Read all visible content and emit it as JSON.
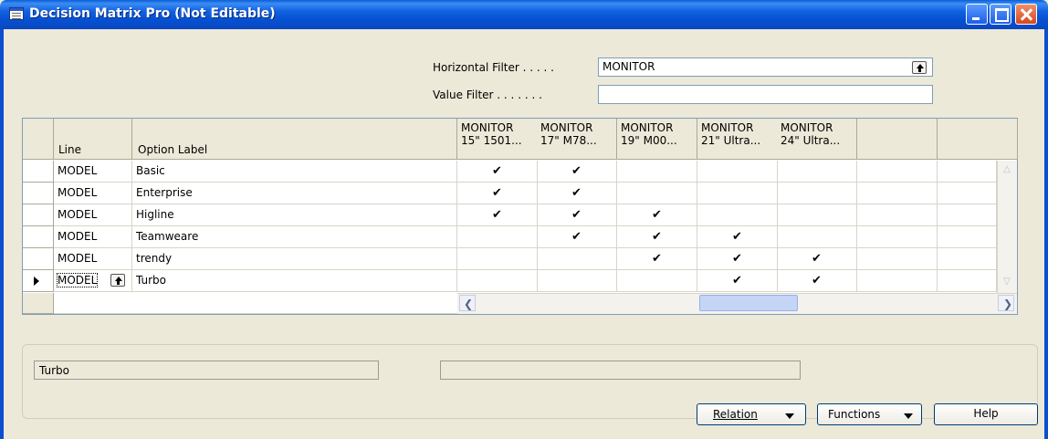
{
  "window": {
    "title": "Decision Matrix Pro (Not Editable)",
    "icon": "table-window-icon"
  },
  "filters": {
    "horizontal_label": "Horizontal Filter . . . . .",
    "horizontal_value": "MONITOR",
    "value_label": "Value Filter . . . . . . .",
    "value_value": ""
  },
  "grid": {
    "col_line": "Line",
    "col_option": "Option Label",
    "matrix_columns": [
      {
        "line1": "MONITOR",
        "line2": "15\" 1501..."
      },
      {
        "line1": "MONITOR",
        "line2": "17\" M78..."
      },
      {
        "line1": "MONITOR",
        "line2": "19\" M00..."
      },
      {
        "line1": "MONITOR",
        "line2": "21\" Ultra..."
      },
      {
        "line1": "MONITOR",
        "line2": "24\" Ultra..."
      },
      {
        "line1": "",
        "line2": ""
      },
      {
        "line1": "",
        "line2": ""
      }
    ],
    "rows": [
      {
        "line": "MODEL",
        "option": "Basic",
        "checks": [
          true,
          true,
          false,
          false,
          false,
          false,
          false
        ]
      },
      {
        "line": "MODEL",
        "option": "Enterprise",
        "checks": [
          true,
          true,
          false,
          false,
          false,
          false,
          false
        ]
      },
      {
        "line": "MODEL",
        "option": "Higline",
        "checks": [
          true,
          true,
          true,
          false,
          false,
          false,
          false
        ]
      },
      {
        "line": "MODEL",
        "option": "Teamweare",
        "checks": [
          false,
          true,
          true,
          true,
          false,
          false,
          false
        ]
      },
      {
        "line": "MODEL",
        "option": "trendy",
        "checks": [
          false,
          false,
          true,
          true,
          true,
          false,
          false
        ]
      },
      {
        "line": "MODEL",
        "option": "Turbo",
        "checks": [
          false,
          false,
          false,
          true,
          true,
          false,
          false
        ]
      }
    ],
    "current_row_index": 5,
    "check_glyph": "✔"
  },
  "status": {
    "left": "Turbo",
    "right": ""
  },
  "buttons": {
    "relation": "Relation",
    "functions": "Functions",
    "help": "Help"
  }
}
